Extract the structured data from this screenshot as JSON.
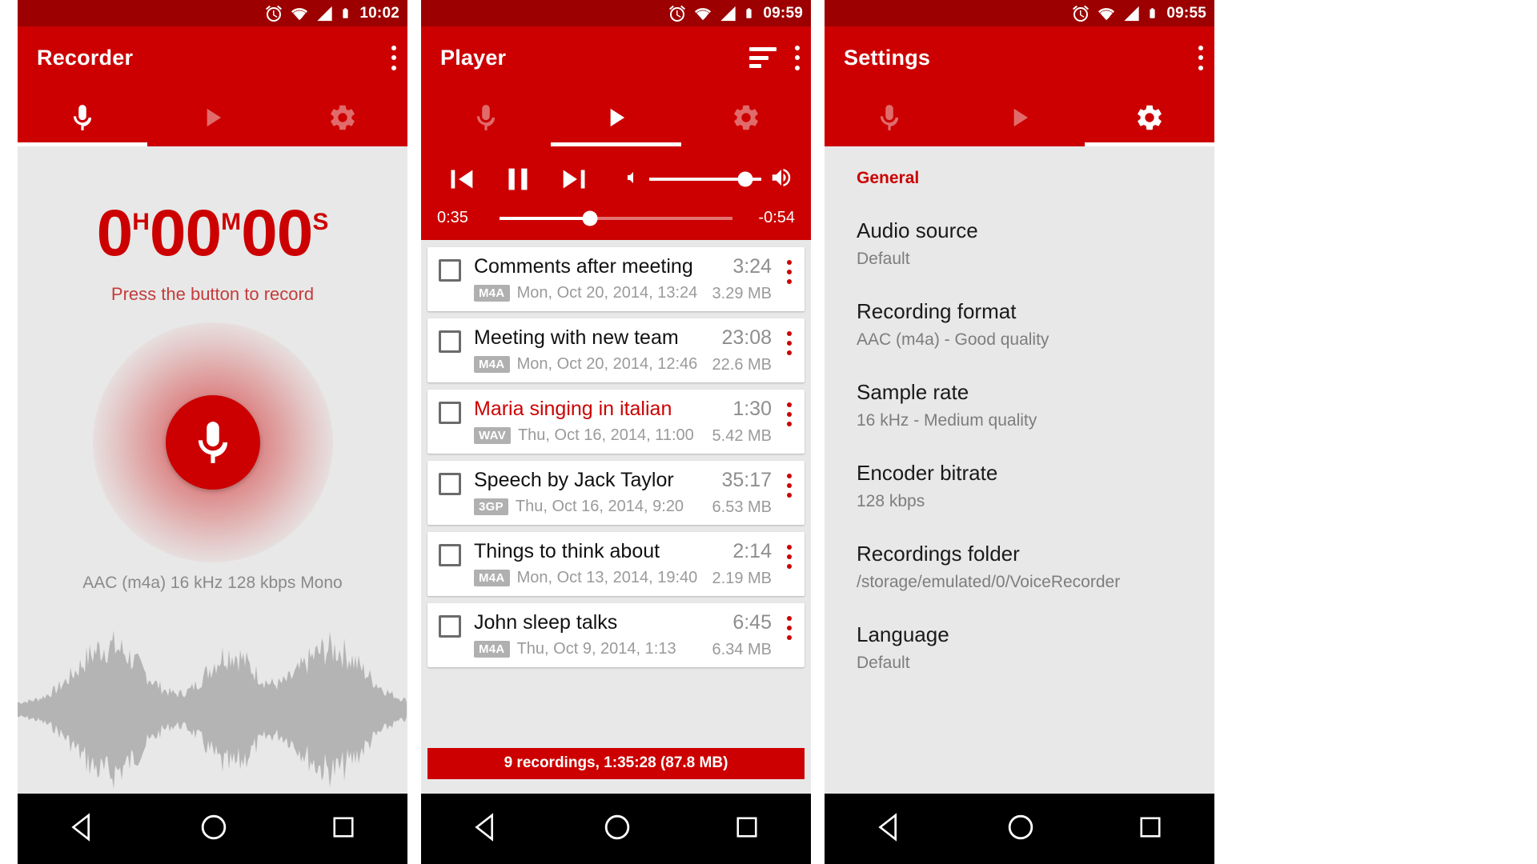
{
  "screens": [
    {
      "id": "recorder",
      "status_time": "10:02",
      "title": "Recorder",
      "tabs": [
        {
          "name": "record",
          "icon": "microphone-icon",
          "active": true
        },
        {
          "name": "play",
          "icon": "play-icon",
          "active": false
        },
        {
          "name": "settings",
          "icon": "gear-icon",
          "active": false
        }
      ],
      "timer": {
        "hours": "0",
        "h_unit": "H",
        "minutes": "00",
        "m_unit": "M",
        "seconds": "00",
        "s_unit": "S"
      },
      "hint": "Press the button to record",
      "format_info": "AAC (m4a) 16 kHz 128 kbps Mono"
    },
    {
      "id": "player",
      "status_time": "09:59",
      "title": "Player",
      "tabs": [
        {
          "name": "record",
          "icon": "microphone-icon",
          "active": false
        },
        {
          "name": "play",
          "icon": "play-icon",
          "active": true
        },
        {
          "name": "settings",
          "icon": "gear-icon",
          "active": false
        }
      ],
      "controls": {
        "previous": "skip-previous-icon",
        "pause": "pause-icon",
        "next": "skip-next-icon",
        "volume_low": "volume-low-icon",
        "volume_high": "volume-high-icon",
        "volume_percent": 86
      },
      "seek": {
        "elapsed": "0:35",
        "remaining": "-0:54",
        "progress_percent": 39
      },
      "recordings": [
        {
          "title": "Comments after meeting",
          "format": "M4A",
          "date": "Mon, Oct 20, 2014, 13:24",
          "duration": "3:24",
          "size": "3.29 MB",
          "playing": false,
          "checked": false
        },
        {
          "title": "Meeting with new team",
          "format": "M4A",
          "date": "Mon, Oct 20, 2014, 12:46",
          "duration": "23:08",
          "size": "22.6 MB",
          "playing": false,
          "checked": false
        },
        {
          "title": "Maria singing in italian",
          "format": "WAV",
          "date": "Thu, Oct 16, 2014, 11:00",
          "duration": "1:30",
          "size": "5.42 MB",
          "playing": true,
          "checked": false
        },
        {
          "title": "Speech by Jack Taylor",
          "format": "3GP",
          "date": "Thu, Oct 16, 2014, 9:20",
          "duration": "35:17",
          "size": "6.53 MB",
          "playing": false,
          "checked": false
        },
        {
          "title": "Things to think about",
          "format": "M4A",
          "date": "Mon, Oct 13, 2014, 19:40",
          "duration": "2:14",
          "size": "2.19 MB",
          "playing": false,
          "checked": false
        },
        {
          "title": "John sleep talks",
          "format": "M4A",
          "date": "Thu, Oct 9, 2014, 1:13",
          "duration": "6:45",
          "size": "6.34 MB",
          "playing": false,
          "checked": false
        }
      ],
      "footer": "9 recordings, 1:35:28 (87.8 MB)"
    },
    {
      "id": "settings",
      "status_time": "09:55",
      "title": "Settings",
      "tabs": [
        {
          "name": "record",
          "icon": "microphone-icon",
          "active": false
        },
        {
          "name": "play",
          "icon": "play-icon",
          "active": false
        },
        {
          "name": "settings",
          "icon": "gear-icon",
          "active": true
        }
      ],
      "section": "General",
      "items": [
        {
          "title": "Audio source",
          "value": "Default"
        },
        {
          "title": "Recording format",
          "value": "AAC (m4a) - Good quality"
        },
        {
          "title": "Sample rate",
          "value": "16 kHz - Medium quality"
        },
        {
          "title": "Encoder bitrate",
          "value": "128 kbps"
        },
        {
          "title": "Recordings folder",
          "value": "/storage/emulated/0/VoiceRecorder"
        },
        {
          "title": "Language",
          "value": "Default"
        }
      ]
    }
  ],
  "status_icons": [
    "alarm-icon",
    "wifi-icon",
    "signal-icon",
    "battery-icon"
  ],
  "navbar": [
    "back-icon",
    "home-icon",
    "recents-icon"
  ],
  "colors": {
    "primary": "#cc0000",
    "primary_dark": "#9c0000",
    "background": "#e8e8e8",
    "card": "#ffffff",
    "accent_text": "#cc0000",
    "muted_text": "#9a9a9a"
  }
}
